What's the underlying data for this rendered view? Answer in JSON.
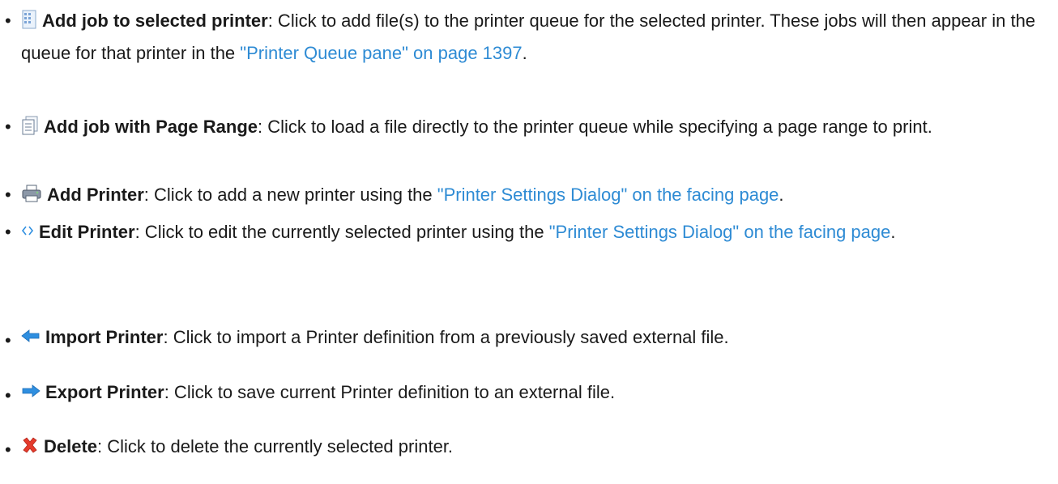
{
  "items": [
    {
      "icon": "add-job-icon",
      "term": "Add job to selected printer",
      "text": ": Click to add file(s) to the printer queue for the selected printer. These jobs will then appear in the queue for that printer in the ",
      "link": "\"Printer Queue pane\" on page 1397",
      "tail": "."
    },
    {
      "icon": "page-range-icon",
      "term": "Add job with Page Range",
      "text": ": Click to load a file directly to the printer queue while specifying a page range to print.",
      "link": "",
      "tail": ""
    },
    {
      "icon": "printer-icon",
      "term": "Add Printer",
      "text": ": Click to add a new printer using the ",
      "link": "\"Printer Settings Dialog\" on the facing page",
      "tail": "."
    },
    {
      "icon": "edit-icon",
      "term": "Edit Printer",
      "text": ": Click to edit the currently selected printer using the ",
      "link": "\"Printer Settings Dialog\" on the facing page",
      "tail": "."
    },
    {
      "icon": "import-arrow-icon",
      "term": "Import Printer",
      "text": ": Click to import a Printer definition from a previously saved external file.",
      "link": "",
      "tail": ""
    },
    {
      "icon": "export-arrow-icon",
      "term": "Export Printer",
      "text": ": Click to save current Printer definition to an external file.",
      "link": "",
      "tail": ""
    },
    {
      "icon": "delete-icon",
      "term": "Delete",
      "text": ": Click to delete the currently selected printer.",
      "link": "",
      "tail": ""
    }
  ],
  "bullet": "•",
  "colors": {
    "link": "#2e8bd4",
    "text": "#1a1a1a",
    "delete": "#e53b2c",
    "arrow": "#2f8fe0"
  }
}
